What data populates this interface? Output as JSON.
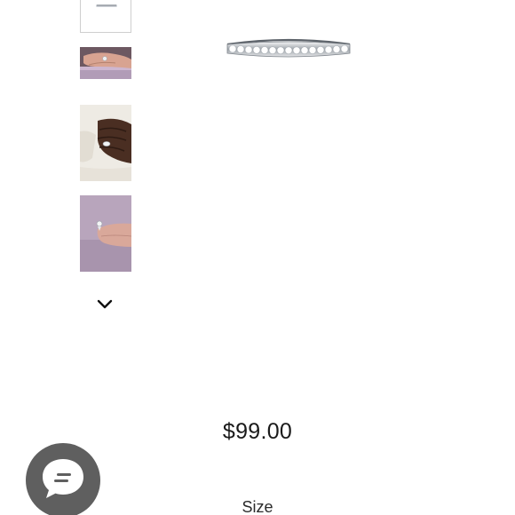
{
  "product": {
    "price": "$99.00",
    "size_label": "Size"
  },
  "gallery": {
    "thumbnails": [
      {
        "name": "thumbnail-ring-band"
      },
      {
        "name": "thumbnail-hand-purple"
      },
      {
        "name": "thumbnail-hand-sweater"
      },
      {
        "name": "thumbnail-hand-fingertips"
      }
    ],
    "scroll_icon": "chevron-down-icon"
  },
  "chat": {
    "icon": "chat-bubble-icon",
    "color": "#5f5f5f"
  }
}
